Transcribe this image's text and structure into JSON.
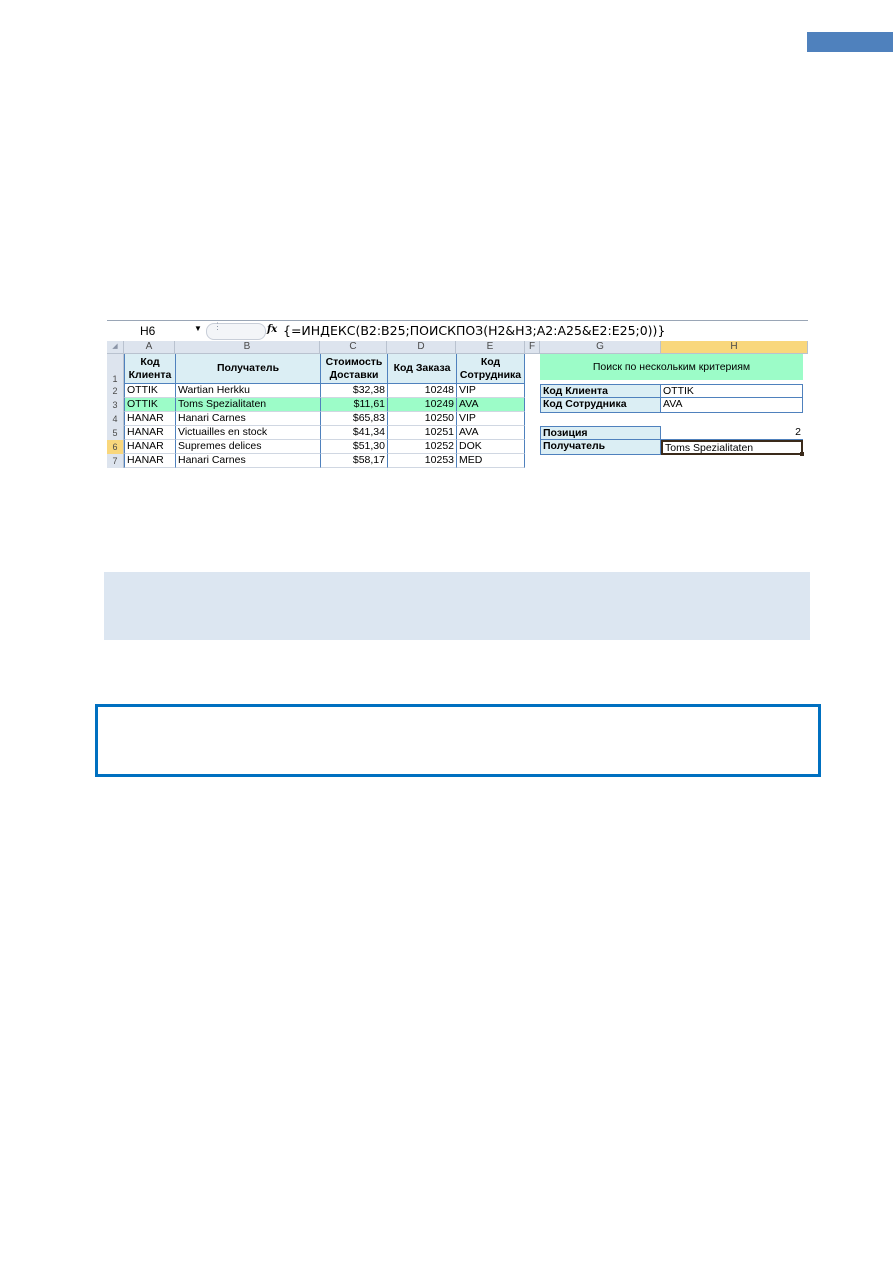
{
  "formula_bar": {
    "name_box": "H6",
    "fx": "fx",
    "formula": "{=ИНДЕКС(B2:B25;ПОИСКПОЗ(H2&H3;A2:A25&E2:E25;0))}"
  },
  "sheet": {
    "columns": [
      "A",
      "B",
      "C",
      "D",
      "E",
      "F",
      "G",
      "H"
    ],
    "selected_column": "H",
    "selected_row": "6",
    "row_numbers": [
      "1",
      "2",
      "3",
      "4",
      "5",
      "6",
      "7"
    ],
    "headers": {
      "a": "Код Клиента",
      "b": "Получатель",
      "c": "Стоимость Доставки",
      "d": "Код Заказа",
      "e": "Код Сотрудника"
    },
    "rows": [
      {
        "a": "OTTIK",
        "b": "Wartian Herkku",
        "c": "$32,38",
        "d": "10248",
        "e": "VIP"
      },
      {
        "a": "OTTIK",
        "b": "Toms Spezialitaten",
        "c": "$11,61",
        "d": "10249",
        "e": "AVA"
      },
      {
        "a": "HANAR",
        "b": "Hanari Carnes",
        "c": "$65,83",
        "d": "10250",
        "e": "VIP"
      },
      {
        "a": "HANAR",
        "b": "Victuailles en stock",
        "c": "$41,34",
        "d": "10251",
        "e": "AVA"
      },
      {
        "a": "HANAR",
        "b": "Supremes delices",
        "c": "$51,30",
        "d": "10252",
        "e": "DOK"
      },
      {
        "a": "HANAR",
        "b": "Hanari Carnes",
        "c": "$58,17",
        "d": "10253",
        "e": "MED"
      }
    ],
    "lookup": {
      "title": "Поиск по нескольким критериям",
      "client_label": "Код Клиента",
      "client_value": "OTTIK",
      "employee_label": "Код Сотрудника",
      "employee_value": "AVA",
      "position_label": "Позиция",
      "position_value": "2",
      "recipient_label": "Получатель",
      "recipient_value": "Toms Spezialitaten"
    },
    "colors": {
      "highlight_row": "#9cfcc8",
      "header_fill": "#dbeef4",
      "border_blue": "#4f81bd",
      "selected_header": "#f9d77c"
    }
  }
}
